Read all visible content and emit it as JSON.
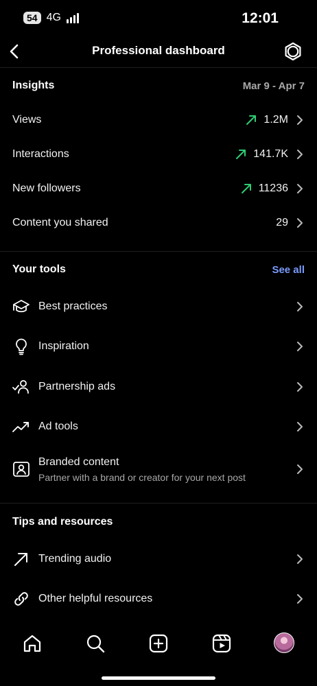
{
  "status": {
    "battery": "54",
    "network": "4G",
    "time": "12:01"
  },
  "header": {
    "title": "Professional dashboard"
  },
  "insights": {
    "title": "Insights",
    "date_range": "Mar 9 - Apr 7",
    "rows": [
      {
        "label": "Views",
        "value": "1.2M",
        "trend": "up"
      },
      {
        "label": "Interactions",
        "value": "141.7K",
        "trend": "up"
      },
      {
        "label": "New followers",
        "value": "11236",
        "trend": "up"
      },
      {
        "label": "Content you shared",
        "value": "29"
      }
    ]
  },
  "tools": {
    "title": "Your tools",
    "see_all": "See all",
    "items": [
      {
        "label": "Best practices",
        "icon": "graduation-cap-icon"
      },
      {
        "label": "Inspiration",
        "icon": "lightbulb-icon"
      },
      {
        "label": "Partnership ads",
        "icon": "partnership-icon"
      },
      {
        "label": "Ad tools",
        "icon": "trend-up-icon"
      },
      {
        "label": "Branded content",
        "subtitle": "Partner with a brand or creator for your next post",
        "icon": "branded-content-icon"
      }
    ]
  },
  "tips": {
    "title": "Tips and resources",
    "items": [
      {
        "label": "Trending audio",
        "icon": "arrow-up-right-icon"
      },
      {
        "label": "Other helpful resources",
        "icon": "link-icon"
      }
    ]
  },
  "colors": {
    "background": "#000000",
    "trend_up": "#2ecc71",
    "link": "#7b9cff"
  },
  "tabbar": [
    "home-icon",
    "search-icon",
    "create-icon",
    "reels-icon",
    "profile-avatar"
  ]
}
